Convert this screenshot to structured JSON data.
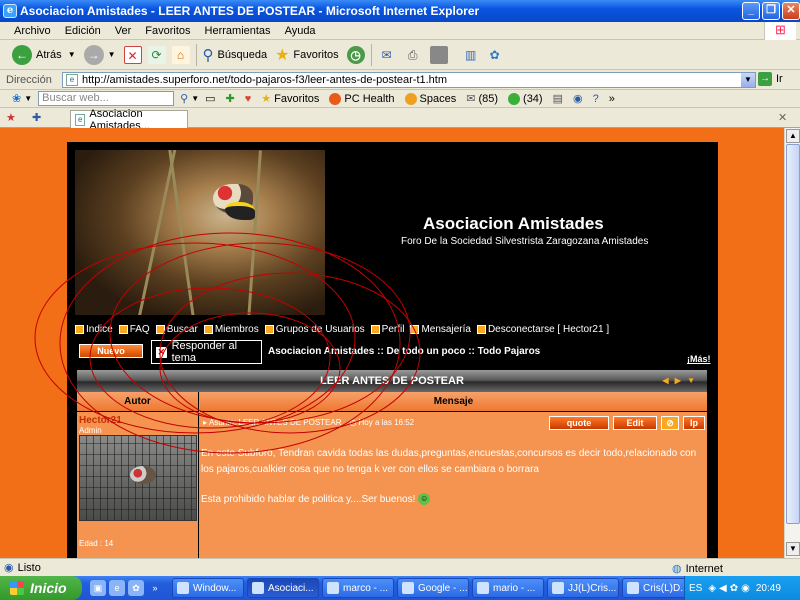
{
  "window": {
    "title": "Asociacion Amistades - LEER ANTES DE POSTEAR - Microsoft Internet Explorer",
    "minimize_icon": "minimize-icon",
    "maximize_icon": "maximize-icon",
    "close_icon": "close-icon"
  },
  "menu": {
    "items": [
      "Archivo",
      "Edición",
      "Ver",
      "Favoritos",
      "Herramientas",
      "Ayuda"
    ]
  },
  "toolbar": {
    "back_label": "Atrás",
    "search_label": "Búsqueda",
    "favorites_label": "Favoritos"
  },
  "address": {
    "label": "Dirección",
    "url": "http://amistades.superforo.net/todo-pajaros-f3/leer-antes-de-postear-t1.htm",
    "go_label": "Ir"
  },
  "livebar": {
    "search_placeholder": "Buscar web...",
    "favorites_label": "Favoritos",
    "pchealth_label": "PC Health",
    "spaces_label": "Spaces",
    "mail_count": "(85)",
    "contacts_count": "(34)"
  },
  "tab": {
    "label": "Asociacion Amistades..."
  },
  "forum": {
    "site_title": "Asociacion Amistades",
    "site_subtitle": "Foro De la Sociedad Silvestrista Zaragozana Amistades",
    "nav": [
      "Indice",
      "FAQ",
      "Buscar",
      "Miembros",
      "Grupos de Usuarios",
      "Perfil",
      "Mensajería",
      "Desconectarse [ Hector21 ]"
    ],
    "new_button_label": "Nuevo",
    "reply_button_label": "Responder al tema",
    "breadcrumb": "Asociacion Amistades :: De todo un poco :: Todo Pajaros",
    "more_link": "¡Más!",
    "topic_title": "LEER ANTES DE POSTEAR",
    "col_author": "Autor",
    "col_message": "Mensaje",
    "post": {
      "author": "Hector21",
      "rank": "Admin",
      "age": "Edad : 14",
      "subject": "Asunto: LEER ANTES DE POSTEAR",
      "date": "Hoy a las 16:52",
      "quote_label": "quote",
      "edit_label": "Edit",
      "ip_label": "Ip",
      "text_1": "En este Subforo, Tendran cavida todas las dudas,preguntas,encuestas,concursos es decir todo,relacionado con los pajaros,cualkier cosa que no tenga k ver con ellos se cambiara o borrara",
      "text_2": "Esta prohibido hablar de politica y....Ser buenos!"
    }
  },
  "status": {
    "text": "Listo",
    "zone": "Internet"
  },
  "taskbar": {
    "start_label": "Inicio",
    "tasks": [
      "Window...",
      "Asociaci...",
      "marco - ...",
      "Google - ...",
      "mario - ...",
      "JJ(L)Cris...",
      "Cris(L)D..."
    ],
    "lang": "ES",
    "clock": "20:49"
  }
}
